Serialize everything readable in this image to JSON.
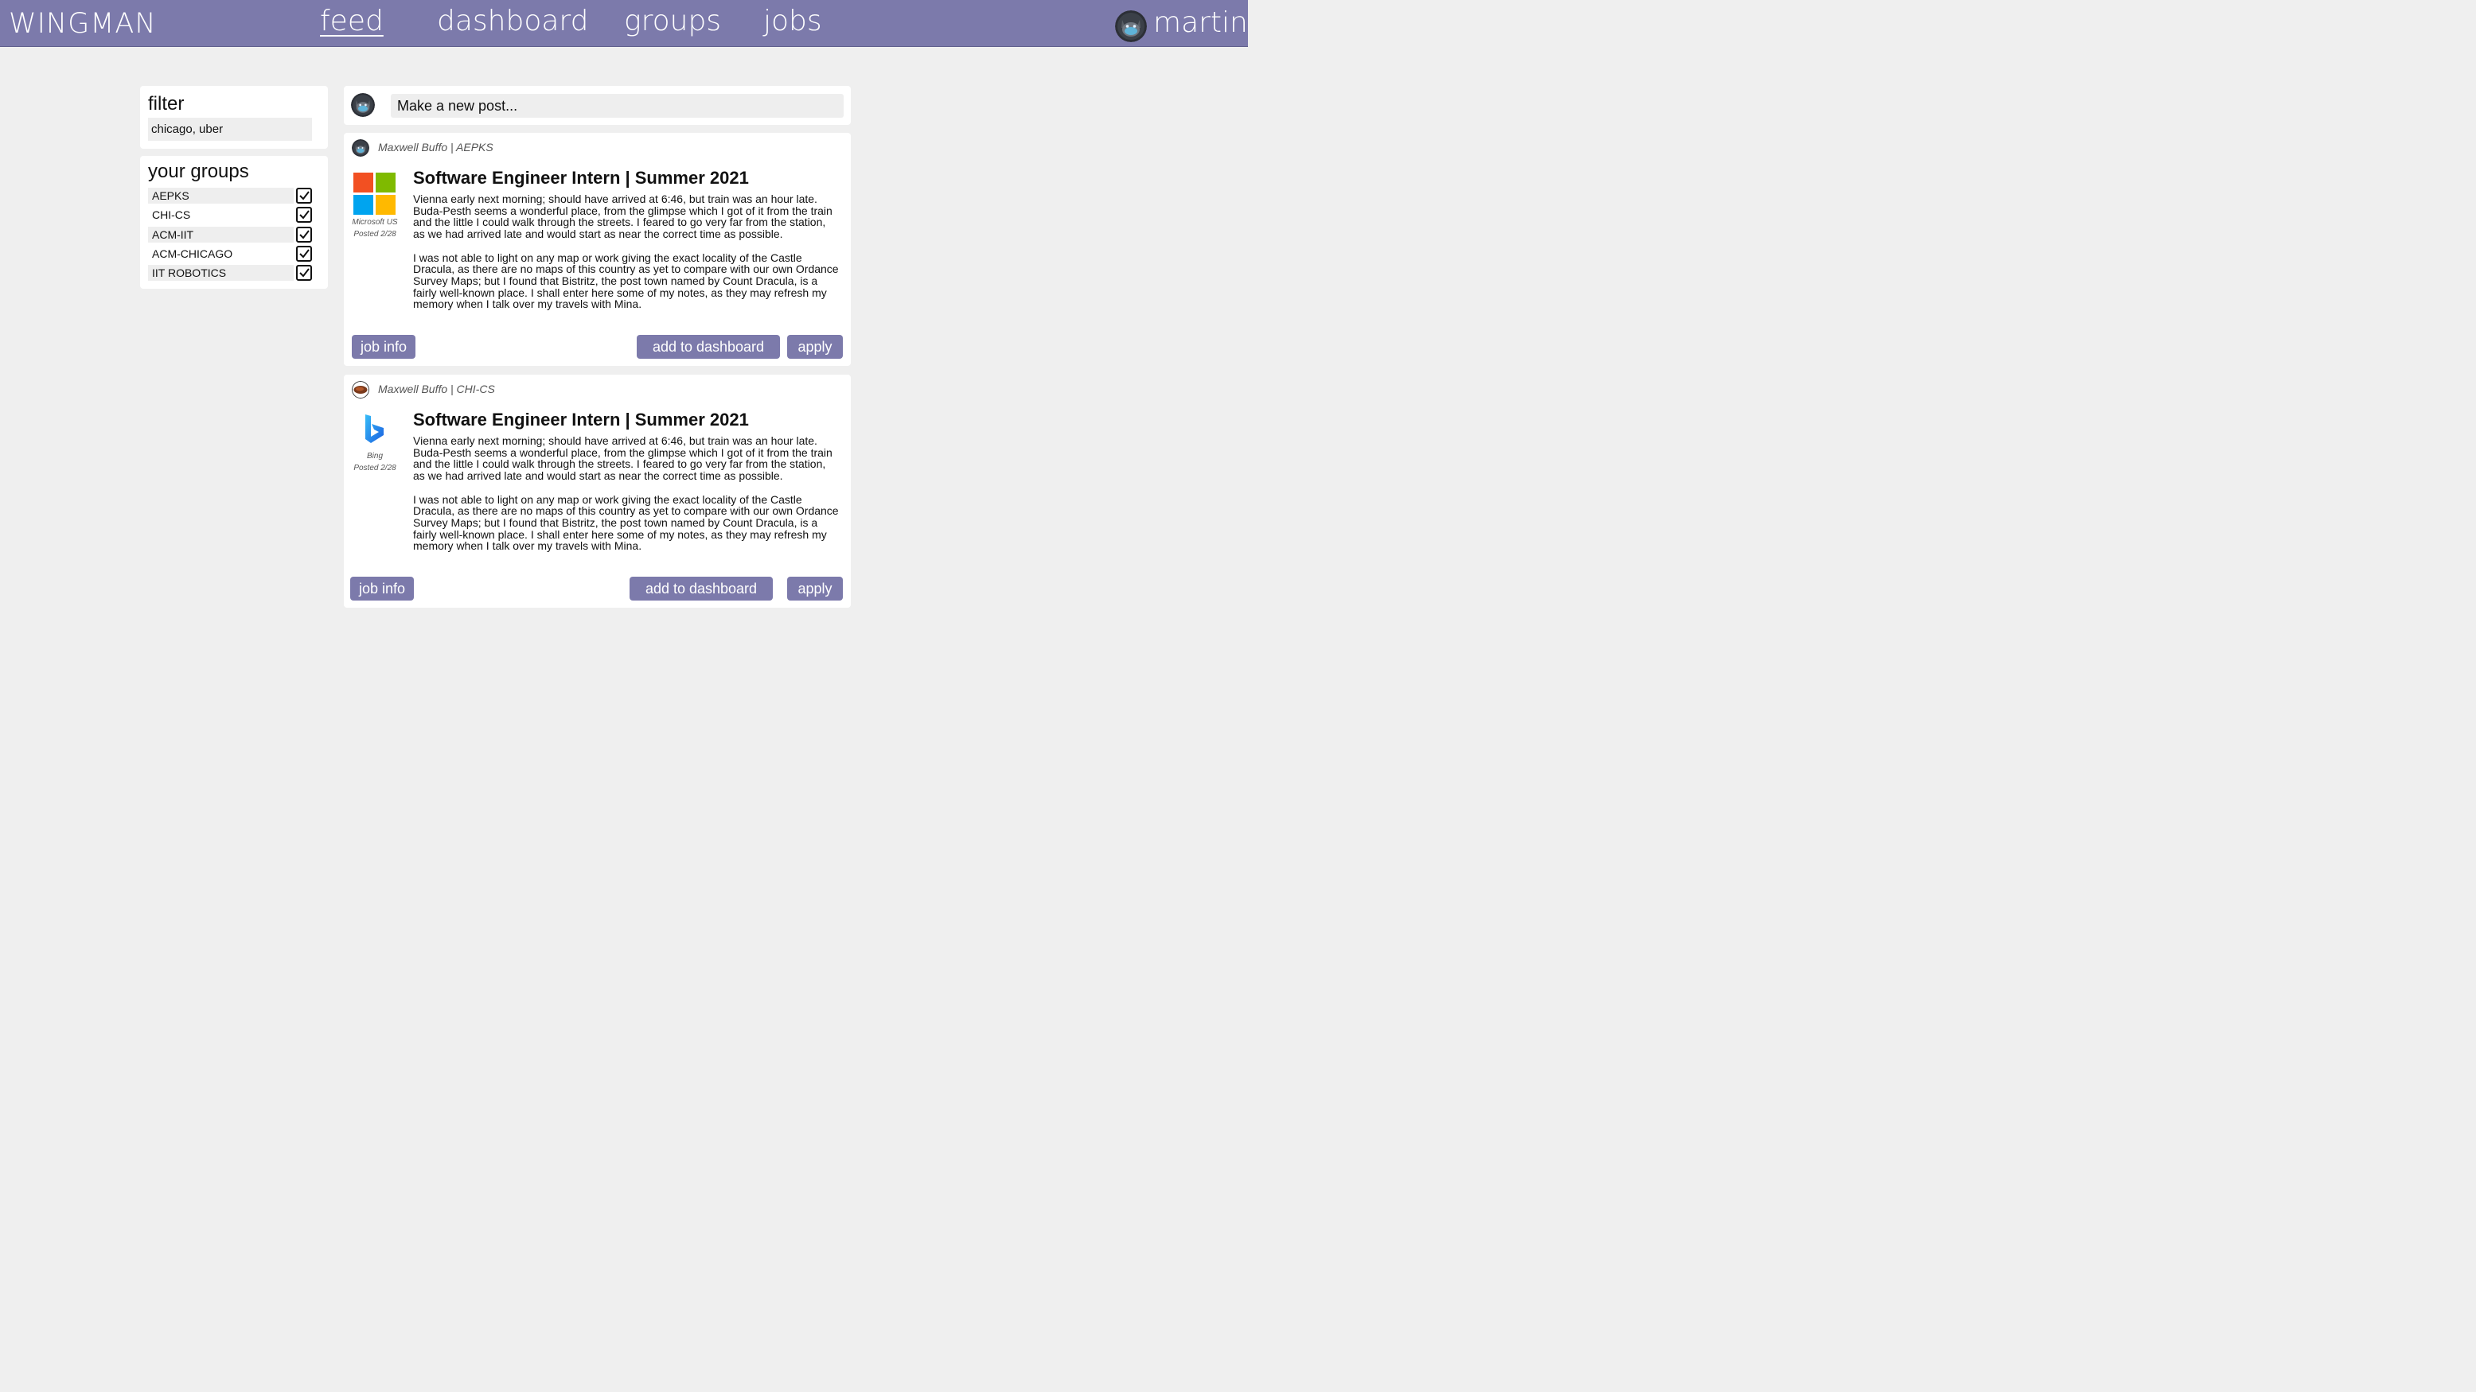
{
  "header": {
    "brand": "WINGMAN",
    "nav": [
      {
        "label": "feed",
        "active": true
      },
      {
        "label": "dashboard",
        "active": false
      },
      {
        "label": "groups",
        "active": false
      },
      {
        "label": "jobs",
        "active": false
      }
    ],
    "username": "martin",
    "avatar_icon": "cat-avatar-icon",
    "bar_color": "#7c7aab"
  },
  "filter": {
    "title": "filter",
    "value": "chicago, uber"
  },
  "groups": {
    "title": "your groups",
    "items": [
      {
        "label": "AEPKS",
        "checked": true
      },
      {
        "label": "CHI-CS",
        "checked": true
      },
      {
        "label": "ACM-IIT",
        "checked": true
      },
      {
        "label": "ACM-CHICAGO",
        "checked": true
      },
      {
        "label": "IIT ROBOTICS",
        "checked": true
      }
    ]
  },
  "new_post": {
    "placeholder": "Make a new post..."
  },
  "posts": [
    {
      "author": "Maxwell Buffo | AEPKS",
      "company": "Microsoft US",
      "company_icon": "microsoft-logo-icon",
      "posted": "Posted 2/28",
      "title": "Software Engineer Intern | Summer 2021",
      "paragraph_1": "Vienna early next morning; should have arrived at 6:46, but train was an hour late. Buda-Pesth seems a wonderful place, from the glimpse which I got of it from the train and the little I could walk through the streets. I feared to go very far from the station, as we had arrived late and would start as near the correct time as possible.",
      "paragraph_2": "I was not able to light on any map or work giving the exact locality of the Castle Dracula, as there are no maps of this country as yet to compare with our own Ordance Survey Maps; but I found that Bistritz, the post town named by Count Dracula, is a fairly well-known place. I shall enter here some of my notes, as they may refresh my memory when I talk over my travels with Mina.",
      "job_info_label": "job info",
      "dashboard_label": "add to dashboard",
      "apply_label": "apply"
    },
    {
      "author": "Maxwell Buffo | CHI-CS",
      "company": "Bing",
      "company_icon": "bing-logo-icon",
      "posted": "Posted 2/28",
      "title": "Software Engineer Intern | Summer 2021",
      "paragraph_1": "Vienna early next morning; should have arrived at 6:46, but train was an hour late. Buda-Pesth seems a wonderful place, from the glimpse which I got of it from the train and the little I could walk through the streets. I feared to go very far from the station, as we had arrived late and would start as near the correct time as possible.",
      "paragraph_2": "I was not able to light on any map or work giving the exact locality of the Castle Dracula, as there are no maps of this country as yet to compare with our own Ordance Survey Maps; but I found that Bistritz, the post town named by Count Dracula, is a fairly well-known place. I shall enter here some of my notes, as they may refresh my memory when I talk over my travels with Mina.",
      "job_info_label": "job info",
      "dashboard_label": "add to dashboard",
      "apply_label": "apply"
    }
  ]
}
